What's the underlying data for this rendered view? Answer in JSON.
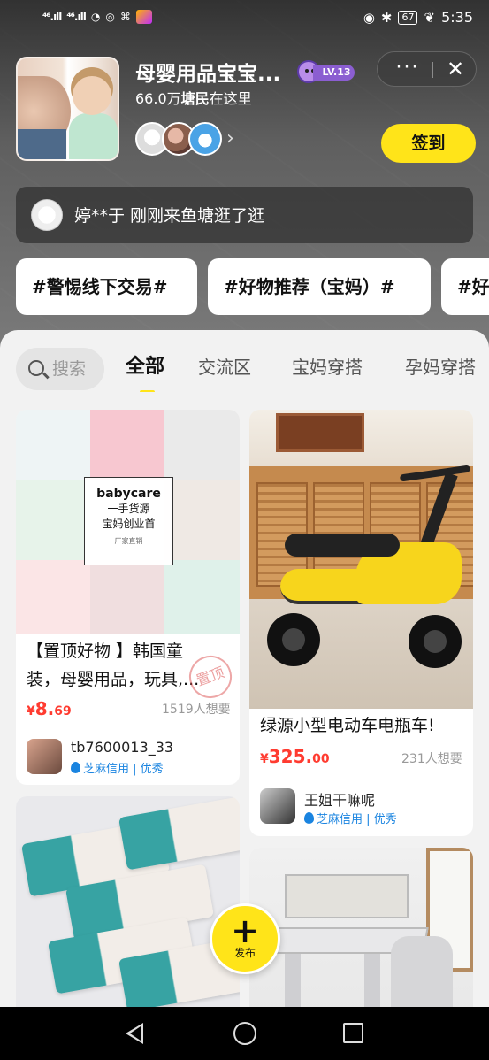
{
  "status_bar": {
    "signal1": "⁴⁶.ıll",
    "signal2": "⁴⁶.ıll",
    "battery": "67",
    "time": "5:35"
  },
  "group": {
    "title": "母婴用品宝宝...",
    "level": "LV.13",
    "member_count_num": "66.0万",
    "member_count_word": "塘民",
    "member_count_suffix": "在这里",
    "sign_in_label": "签到",
    "more_icon": "···",
    "close_icon": "✕"
  },
  "notice": {
    "text": "婷**于 刚刚来鱼塘逛了逛"
  },
  "topics": [
    "#警惕线下交易#",
    "#好物推荐（宝妈）#",
    "#好"
  ],
  "search": {
    "placeholder": "搜索"
  },
  "tabs": [
    {
      "label": "全部",
      "active": true
    },
    {
      "label": "交流区",
      "active": false
    },
    {
      "label": "宝妈穿搭",
      "active": false
    },
    {
      "label": "孕妈穿搭",
      "active": false
    }
  ],
  "feed": {
    "left": [
      {
        "image_text": {
          "brand": "babycare",
          "line1": "一手货源",
          "line2": "宝妈创业首",
          "line3": "厂家直销"
        },
        "title_line1": "【置顶好物 】韩国童",
        "title_line2": "装，母婴用品，玩具,...",
        "stamp": "置顶",
        "price_symbol": "¥",
        "price_int": "8.",
        "price_dec": "69",
        "wants": "1519人想要",
        "user": "tb7600013_33",
        "credit": "芝麻信用 | 优秀"
      },
      {
        "title_line1": "",
        "image": "tissues"
      }
    ],
    "right": [
      {
        "title": "绿源小型电动车电瓶车!",
        "price_symbol": "¥",
        "price_int": "325.",
        "price_dec": "00",
        "wants": "231人想要",
        "user": "王姐干嘛呢",
        "credit": "芝麻信用 | 优秀"
      },
      {
        "image": "desk"
      }
    ]
  },
  "fab": {
    "icon": "+",
    "label": "发布"
  },
  "colors": {
    "accent": "#ffe419",
    "price": "#ff3b30",
    "credit": "#1a84e0"
  }
}
